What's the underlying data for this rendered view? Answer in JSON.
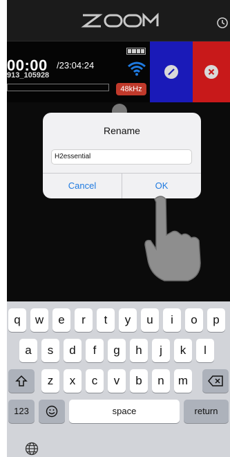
{
  "header": {
    "logo_text": "ZOOM",
    "history_icon": "history-icon"
  },
  "status": {
    "timecode": "00:00",
    "remaining": "/23:04:24",
    "filename": "913_105928",
    "sample_rate": "48kHz",
    "battery_icon": "battery-icon",
    "wifi_icon": "wifi-icon"
  },
  "dialog": {
    "title": "Rename",
    "input_value": "H2essential",
    "cancel_label": "Cancel",
    "ok_label": "OK"
  },
  "keyboard": {
    "row1": [
      "q",
      "w",
      "e",
      "r",
      "t",
      "y",
      "u",
      "i",
      "o",
      "p"
    ],
    "row2": [
      "a",
      "s",
      "d",
      "f",
      "g",
      "h",
      "j",
      "k",
      "l"
    ],
    "row3": [
      "z",
      "x",
      "c",
      "v",
      "b",
      "n",
      "m"
    ],
    "numbers_label": "123",
    "space_label": "space",
    "return_label": "return",
    "shift_icon": "shift-icon",
    "backspace_icon": "backspace-icon",
    "emoji_icon": "emoji-icon",
    "globe_icon": "globe-icon"
  },
  "colors": {
    "accent_blue": "#1f7ae0",
    "button_blue": "#1a1ab8",
    "button_red": "#c8191a",
    "badge_red": "#c0392b"
  }
}
